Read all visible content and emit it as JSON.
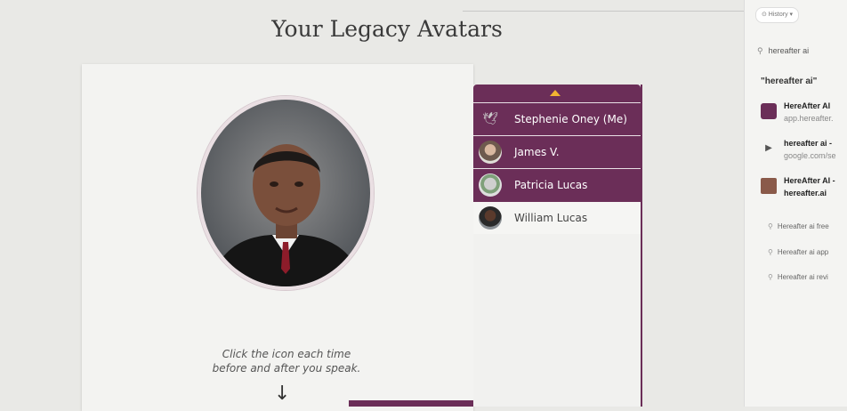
{
  "page": {
    "title": "Your Legacy Avatars"
  },
  "avatars": [
    {
      "name": "Stephenie Oney  (Me)",
      "selected": false
    },
    {
      "name": "James V.",
      "selected": false
    },
    {
      "name": "Patricia Lucas",
      "selected": false
    },
    {
      "name": "William Lucas",
      "selected": true
    }
  ],
  "instructions": {
    "line1": "Click the icon each time",
    "line2": "before and after you speak.",
    "arrow": "↓"
  },
  "browser": {
    "history_tab": "⊙ History  ▾",
    "search_value": "hereafter ai",
    "query_heading": "\"hereafter ai\"",
    "results": [
      {
        "title": "HereAfter AI",
        "url": "app.hereafter.",
        "icon_color": "#6b2e58"
      },
      {
        "title": "hereafter ai - ",
        "url": "google.com/se",
        "icon_color": "#555555"
      },
      {
        "title": "HereAfter AI -",
        "url": "hereafter.ai",
        "icon_color": "#8a5a4a"
      }
    ],
    "suggestions": [
      "Hereafter ai free",
      "Hereafter ai app",
      "Hereafter ai revi"
    ]
  },
  "colors": {
    "accent_purple": "#6b2e58",
    "caret_yellow": "#f2b431"
  }
}
